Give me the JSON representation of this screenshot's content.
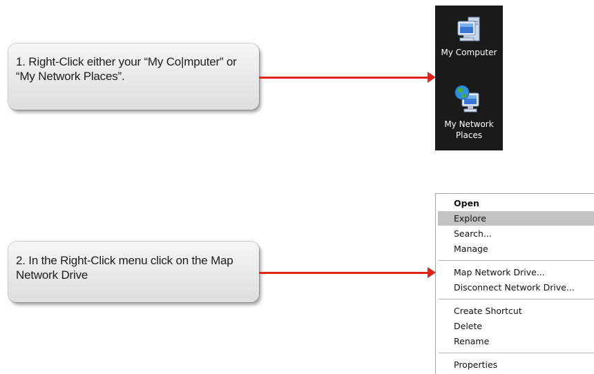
{
  "steps": [
    {
      "line1": "1. Right-Click either your “My Co|mputer” or",
      "line2": "“My Network Places”."
    },
    {
      "line1": "2. In the Right-Click menu click on the Map",
      "line2": "Network Drive"
    }
  ],
  "desktop": {
    "icons": [
      {
        "name": "computer-icon",
        "label_lines": [
          "My Computer"
        ]
      },
      {
        "name": "network-places-icon",
        "label_lines": [
          "My Network",
          "Places"
        ]
      }
    ]
  },
  "context_menu": {
    "items": [
      {
        "label": "Open",
        "bold": true
      },
      {
        "label": "Explore",
        "highlighted": true
      },
      {
        "label": "Search..."
      },
      {
        "label": "Manage"
      },
      {
        "label": "Map Network Drive..."
      },
      {
        "label": "Disconnect Network Drive..."
      },
      {
        "label": "Create Shortcut"
      },
      {
        "label": "Delete"
      },
      {
        "label": "Rename"
      },
      {
        "label": "Properties"
      }
    ]
  },
  "colors": {
    "arrow": "#e2231a",
    "desktop_bg": "#1a1a1a",
    "menu_highlight": "#c3c3c3"
  }
}
